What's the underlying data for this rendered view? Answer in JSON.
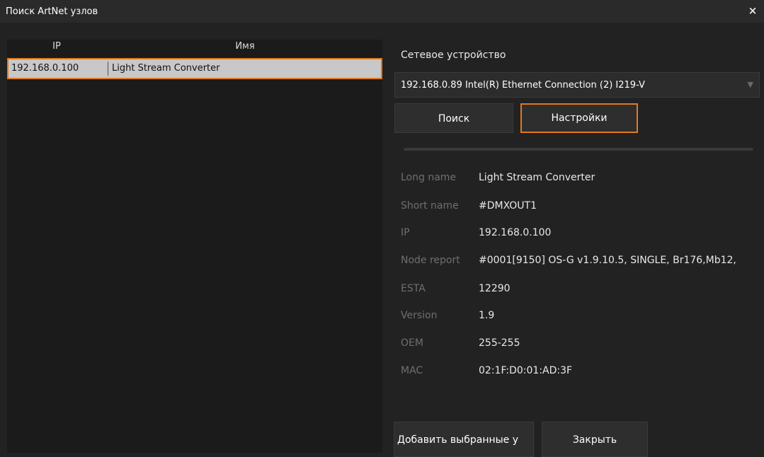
{
  "window": {
    "title": "Поиск ArtNet узлов",
    "close_label": "×"
  },
  "list": {
    "columns": [
      "IP",
      "Имя"
    ],
    "rows": [
      {
        "ip": "192.168.0.100",
        "name": "Light Stream Converter"
      }
    ]
  },
  "network": {
    "label": "Сетевое устройство",
    "selected": "192.168.0.89 Intel(R) Ethernet Connection (2) I219-V"
  },
  "buttons": {
    "search": "Поиск",
    "settings": "Настройки",
    "add_selected": "Добавить выбранные у",
    "close": "Закрыть"
  },
  "properties": [
    {
      "key": "Long name",
      "value": "Light Stream Converter"
    },
    {
      "key": "Short name",
      "value": "#DMXOUT1"
    },
    {
      "key": "IP",
      "value": "192.168.0.100"
    },
    {
      "key": "Node report",
      "value": "#0001[9150] OS-G v1.9.10.5, SINGLE, Br176,Mb12,"
    },
    {
      "key": "ESTA",
      "value": "12290"
    },
    {
      "key": "Version",
      "value": "1.9"
    },
    {
      "key": "OEM",
      "value": "255-255"
    },
    {
      "key": "MAC",
      "value": "02:1F:D0:01:AD:3F"
    }
  ],
  "colors": {
    "accent": "#e07a1f",
    "background": "#222222",
    "selected_row": "#c8c8c8"
  }
}
